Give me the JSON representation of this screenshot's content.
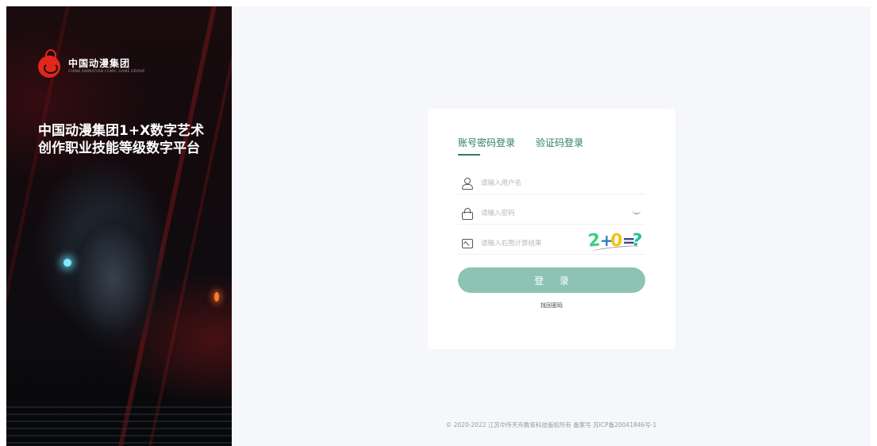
{
  "brand": {
    "logo_cn": "中国动漫集团",
    "logo_en": "CHINA ANIMATION COMIC GAME GROUP",
    "hero_title": "中国动漫集团1+X数字艺术创作职业技能等级数字平台"
  },
  "login": {
    "tabs": [
      {
        "label": "账号密码登录",
        "active": true
      },
      {
        "label": "验证码登录",
        "active": false
      }
    ],
    "username": {
      "value": "",
      "placeholder": "请输入用户名"
    },
    "password": {
      "value": "",
      "placeholder": "请输入密码"
    },
    "captcha": {
      "value": "",
      "placeholder": "请输入右图计算结果",
      "expression": {
        "a": "2",
        "op": "+",
        "b": "0",
        "eq": "=",
        "q": "?"
      }
    },
    "submit_label": "登 录",
    "forgot_label": "找回密码"
  },
  "footer": {
    "text": "© 2020-2022 江苏中传天舟教育科技版权所有   备案号  苏ICP备20041846号-1"
  },
  "colors": {
    "accent": "#2d7d67",
    "button": "#8cc3b3",
    "background": "#f5f7fa",
    "logo": "#e3261c"
  },
  "icons": [
    "user-icon",
    "lock-icon",
    "image-icon",
    "eye-closed-icon"
  ]
}
